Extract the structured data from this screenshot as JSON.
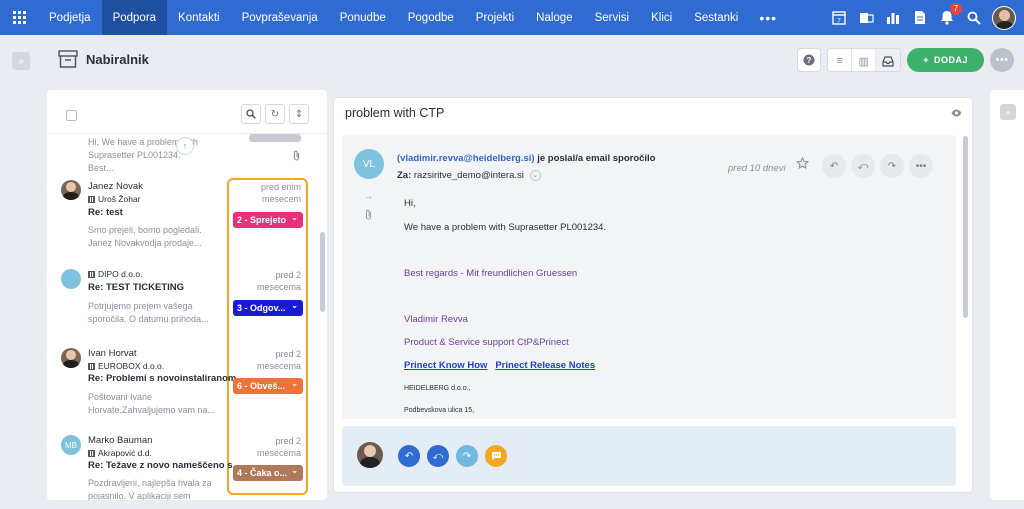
{
  "nav": {
    "items": [
      "Podjetja",
      "Podpora",
      "Kontakti",
      "Povpraševanja",
      "Ponudbe",
      "Pogodbe",
      "Projekti",
      "Naloge",
      "Servisi",
      "Klici",
      "Sestanki"
    ],
    "active": "Podpora",
    "more": "•••",
    "calendar_day": "7",
    "notifications_count": "7"
  },
  "header": {
    "title": "Nabiralnik",
    "add_label": "DODAJ",
    "add_plus": "+",
    "help": "?",
    "more": "•••"
  },
  "list": {
    "partial": {
      "preview": "Hi, We have a problem with Suprasetter PL001234. Best..."
    },
    "items": [
      {
        "name": "Janez Novak",
        "company": "Uroš Žohar",
        "subject": "Re: test",
        "preview": "Smo prejeli, bomo pogledali. Janez Novakvodja prodaje...",
        "date": "pred enim mesecem",
        "status": "2 - Sprejeto",
        "status_color": "#e8317a"
      },
      {
        "name": "",
        "company": "DIPO d.o.o.",
        "subject": "Re: TEST TICKETING",
        "preview": "Potrjujemo prejem vašega sporočila. O datumu prihoda...",
        "date": "pred 2 mesecema",
        "status": "3 - Odgov...",
        "status_color": "#1a1ad6"
      },
      {
        "name": "Ivan Horvat",
        "company": "EUROBOX d.o.o.",
        "subject": "Re: Problemi s novoinstaliranom...",
        "preview": "Poštovani Ivane Horvate,Zahvaljujemo vam na...",
        "date": "pred 2 mesecema",
        "status": "6 - Obveš...",
        "status_color": "#f0713a"
      },
      {
        "name": "Marko Bauman",
        "initials": "MB",
        "company": "Akrapović d.d.",
        "subject": "Re: Težave z novo nameščeno s...",
        "preview": "Pozdravljeni, najlepša hvala za pojasnilo. V aplikaciji sem aktivira...",
        "date": "pred 2 mesecema",
        "status": "4 - Čaka o...",
        "status_color": "#b07a5a"
      }
    ]
  },
  "detail": {
    "title": "problem with CTP",
    "sender_initials": "VL",
    "sender_email": "(vladimir.revva@heidelberg.si)",
    "sent_verb": "je poslal/a email sporočilo",
    "to_label": "Za:",
    "to_value": "razsiritve_demo@intera.si",
    "time": "pred 10 dnevi",
    "body": {
      "greeting": "Hi,",
      "line1": "We have a problem with Suprasetter PL001234.",
      "regards": "Best regards - Mit freundlichen Gruessen",
      "sig_name": "Vladimir Revva",
      "sig_title": "Product & Service support CtP&Prinect",
      "link1": "Prinect Know How",
      "link2": "Prinect Release Notes",
      "company": "HEIDELBERG d.o.o.,",
      "address": "Podbevskova ulica 15,"
    }
  },
  "colors": {
    "nav_bg": "#2f6bd0",
    "nav_active": "#1f4f9f",
    "add_green": "#3db16b",
    "highlight": "#f5a623",
    "reply_blue": "#2f6bd0",
    "forward_light": "#6fb8e0",
    "chat_orange": "#f5a623"
  }
}
